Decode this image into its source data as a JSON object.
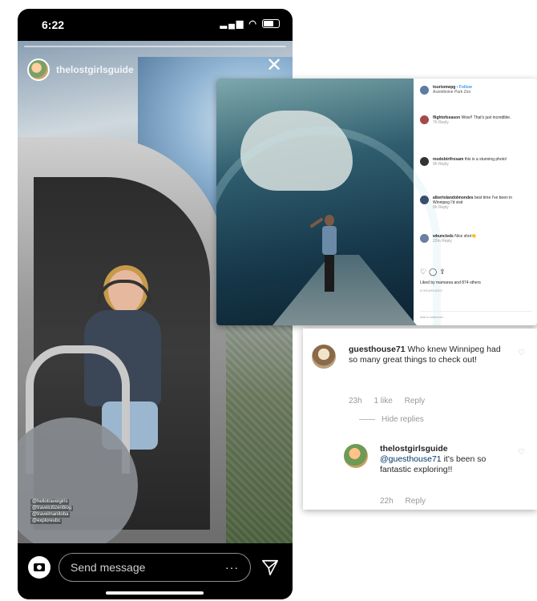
{
  "story": {
    "status_time": "6:22",
    "username": "thelostgirlsguide",
    "mentions": [
      "@hellotravelgirls",
      "@travelcitizenblog",
      "@travelmanitoba",
      "@exploreubc"
    ],
    "message_placeholder": "Send message",
    "more_label": "···"
  },
  "post": {
    "author": "tourismwpg",
    "follow_label": "• Follow",
    "location": "Assiniboine Park Zoo",
    "comments": [
      {
        "user": "flightofseason",
        "text": "Wow!! That's just incredible.",
        "meta": "7h  Reply"
      },
      {
        "user": "modobtrifrosam",
        "text": "this is a stunning photo!",
        "meta": "9h  Reply"
      },
      {
        "user": "albertolandolmondes",
        "text": "best time I've been in Winnipeg I'd visit",
        "meta": "9h  Reply"
      },
      {
        "user": "wbuncleds",
        "text": "Nice shot👏",
        "meta": "22m  Reply"
      }
    ],
    "likes": "Liked by mamarea and 874 others",
    "date": "5 HOURS AGO",
    "add_comment": "Add a comment..."
  },
  "comments": {
    "first": {
      "user": "guesthouse71",
      "text": "Who knew Winnipeg had so many great things to check out!",
      "time": "23h",
      "likes": "1 like",
      "reply": "Reply"
    },
    "hide_replies": "Hide replies",
    "reply": {
      "user": "thelostgirlsguide",
      "mention": "@guesthouse71",
      "text": "it's been so fantastic exploring!!",
      "time": "22h",
      "reply": "Reply"
    }
  }
}
